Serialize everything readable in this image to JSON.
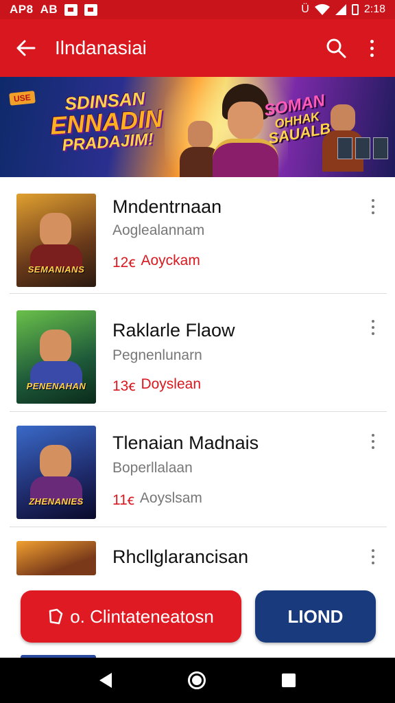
{
  "status_bar": {
    "left_text": "AP8",
    "left_text2": "AB",
    "right_glyph": "Ü",
    "time": "2:18",
    "icons": [
      "notification-icon",
      "notification-icon",
      "vibrate-icon",
      "wifi-icon",
      "signal-icon",
      "battery-icon"
    ]
  },
  "app_bar": {
    "title": "Ilndanasiai",
    "back_icon": "arrow-left-icon",
    "search_icon": "search-icon",
    "more_icon": "more-vert-icon"
  },
  "banner": {
    "tag": "USE",
    "title_line1": "SDINSAN",
    "title_line2": "ENNADIN",
    "title_line3": "PRADAJIM!",
    "title2_line1": "SOMAN",
    "title2_line2": "OHHAK",
    "title2_line3": "SAUALB"
  },
  "games": [
    {
      "title": "Mndentrnaan",
      "subtitle": "Aoglealannam",
      "rating": "12ꞓ",
      "rating_label": "Aoyckam",
      "thumb_label": "SEMANIANS",
      "colors": {
        "bg": "#6a3a1a",
        "bg2": "#e08a2a",
        "body": "#7a1e1e"
      }
    },
    {
      "title": "Raklarle Flaow",
      "subtitle": "Pegnenlunarn",
      "rating": "13ꞓ",
      "rating_label": "Doyslean",
      "thumb_label": "PENENAHAN",
      "colors": {
        "bg": "#1e5a3a",
        "bg2": "#6ac04a",
        "body": "#3a4aa8"
      }
    },
    {
      "title": "Tlenaian Madnais",
      "subtitle": "Boperllalaan",
      "rating": "11ꞓ",
      "rating_label": "Aoyslsam",
      "thumb_label": "ZHENANIES",
      "colors": {
        "bg": "#1e2a6a",
        "bg2": "#3a6ac8",
        "body": "#6a2a7a"
      }
    },
    {
      "title": "Rhcllglarancisan",
      "subtitle": "",
      "rating": "",
      "rating_label": "",
      "thumb_label": "",
      "colors": {
        "bg": "#7a3a1a",
        "bg2": "#f0a030",
        "body": "#5a1a1a"
      }
    }
  ],
  "buttons": {
    "primary_label": "Clintateneatosn",
    "primary_prefix": "o.",
    "primary_icon": "coin-icon",
    "secondary_label": "LIOND"
  },
  "nav": {
    "back_icon": "nav-back-icon",
    "home_icon": "nav-home-icon",
    "recent_icon": "nav-recent-icon"
  },
  "colors": {
    "brand_red": "#d8181e",
    "status_red": "#c8141a",
    "navy": "#1a3a7e"
  }
}
